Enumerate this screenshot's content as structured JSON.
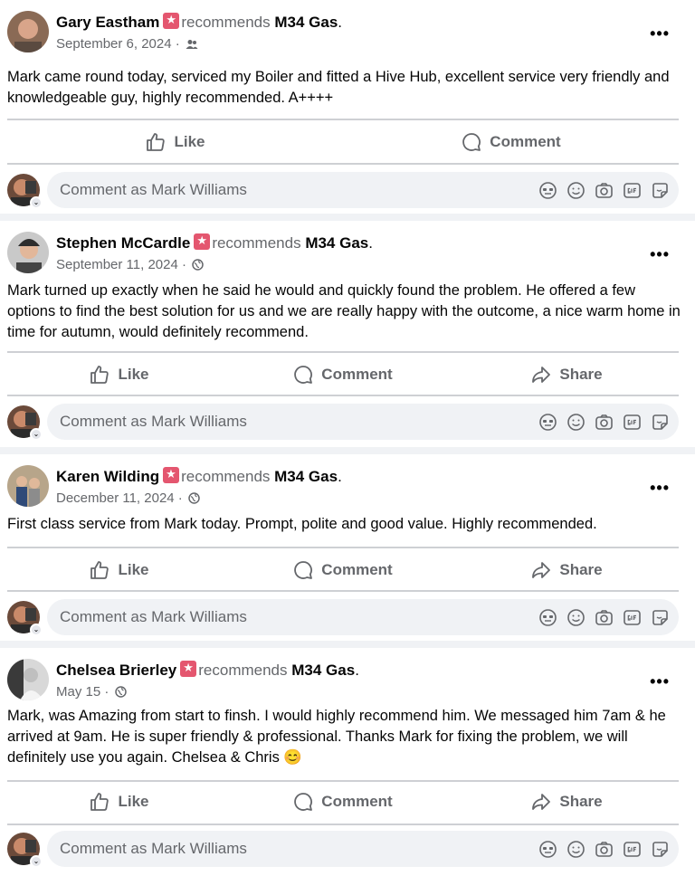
{
  "posts": [
    {
      "author": "Gary Eastham",
      "recommends": "recommends",
      "page": "M34 Gas",
      "date": "September 6, 2024",
      "privacy_icon": "friends-icon",
      "text": "Mark came round today, serviced my Boiler and fitted a Hive Hub, excellent service very friendly and knowledgeable guy, highly recommended. A++++",
      "actions": [
        "Like",
        "Comment"
      ]
    },
    {
      "author": "Stephen McCardle",
      "recommends": "recommends",
      "page": "M34 Gas",
      "date": "September 11, 2024",
      "privacy_icon": "globe-icon",
      "text": "Mark turned up exactly when he said he would and quickly found the problem. He offered a few options to find the best solution for us and we are really happy with the outcome, a nice warm home in time for autumn, would definitely recommend.",
      "actions": [
        "Like",
        "Comment",
        "Share"
      ]
    },
    {
      "author": "Karen Wilding",
      "recommends": "recommends",
      "page": "M34 Gas",
      "date": "December 11, 2024",
      "privacy_icon": "globe-icon",
      "text": "First class service from Mark today. Prompt, polite and good value. Highly recommended.",
      "actions": [
        "Like",
        "Comment",
        "Share"
      ]
    },
    {
      "author": "Chelsea Brierley",
      "recommends": "recommends",
      "page": "M34 Gas",
      "date": "May 15",
      "privacy_icon": "globe-icon",
      "text": "Mark, was Amazing from start to finsh. I would highly recommend him. We messaged him 7am & he arrived at 9am. He is super friendly & professional. Thanks Mark for fixing the problem, we will definitely use you again. Chelsea & Chris 😊",
      "actions": [
        "Like",
        "Comment",
        "Share"
      ]
    }
  ],
  "comment_placeholder": "Comment as Mark Williams",
  "more_label": "•••",
  "colors": {
    "accent_badge": "#e4566f",
    "secondary_text": "#65676b",
    "divider": "#ced0d4"
  }
}
